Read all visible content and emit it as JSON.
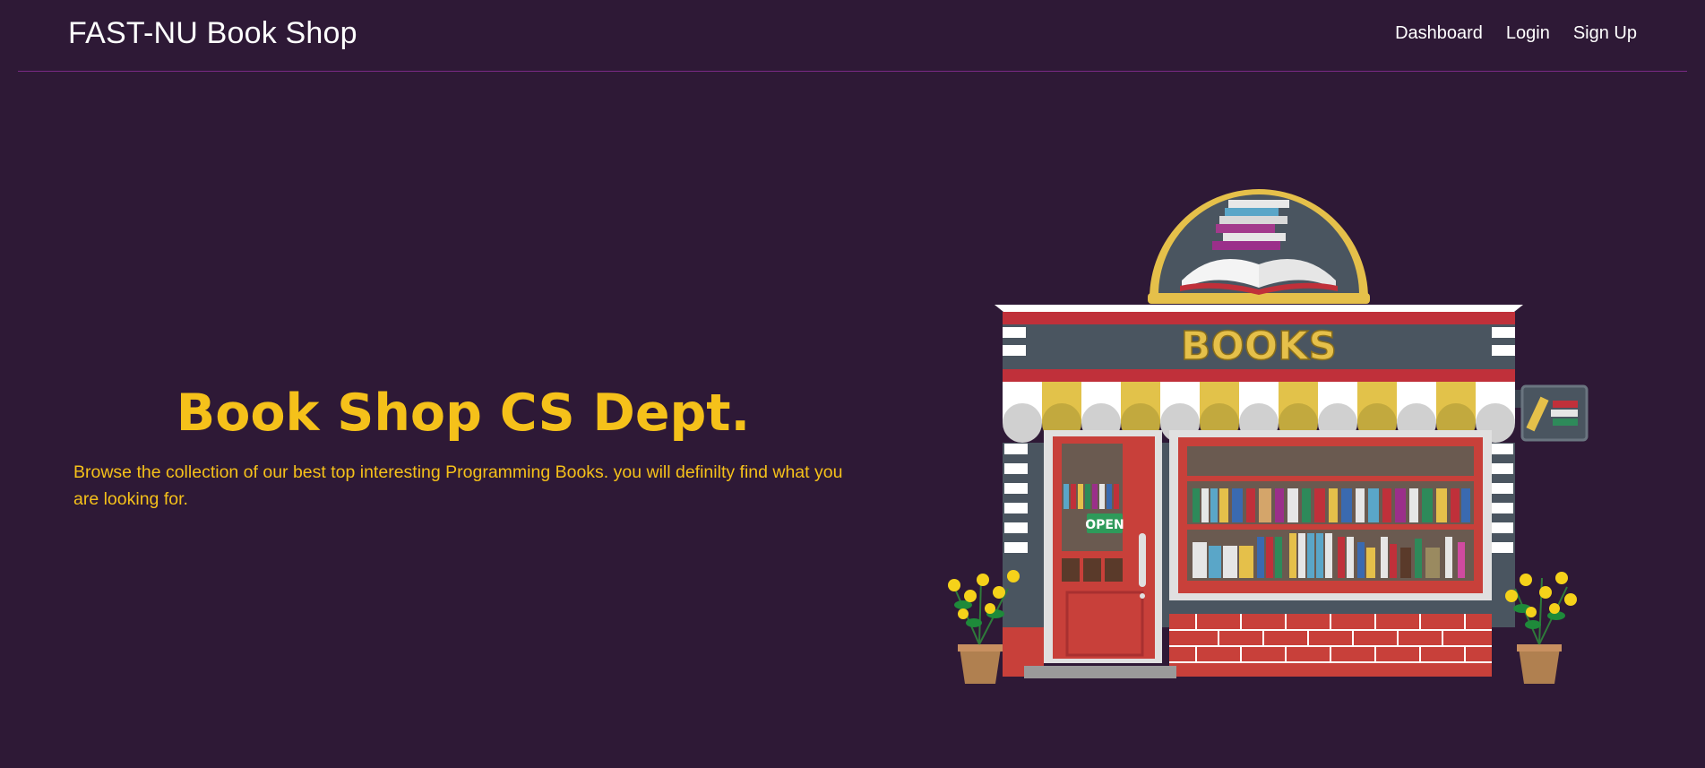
{
  "navbar": {
    "brand": "FAST-NU Book Shop",
    "links": [
      {
        "label": "Dashboard"
      },
      {
        "label": "Login"
      },
      {
        "label": "Sign Up"
      }
    ]
  },
  "hero": {
    "title": "Book Shop CS Dept.",
    "description": "Browse the collection of our best top interesting Programming Books. you will definilty find what you are looking for."
  },
  "illustration": {
    "sign_text": "BOOKS",
    "door_sign": "OPEN"
  },
  "colors": {
    "background": "#2e1936",
    "accent": "#f5c11a",
    "divider": "#7a2a86"
  }
}
